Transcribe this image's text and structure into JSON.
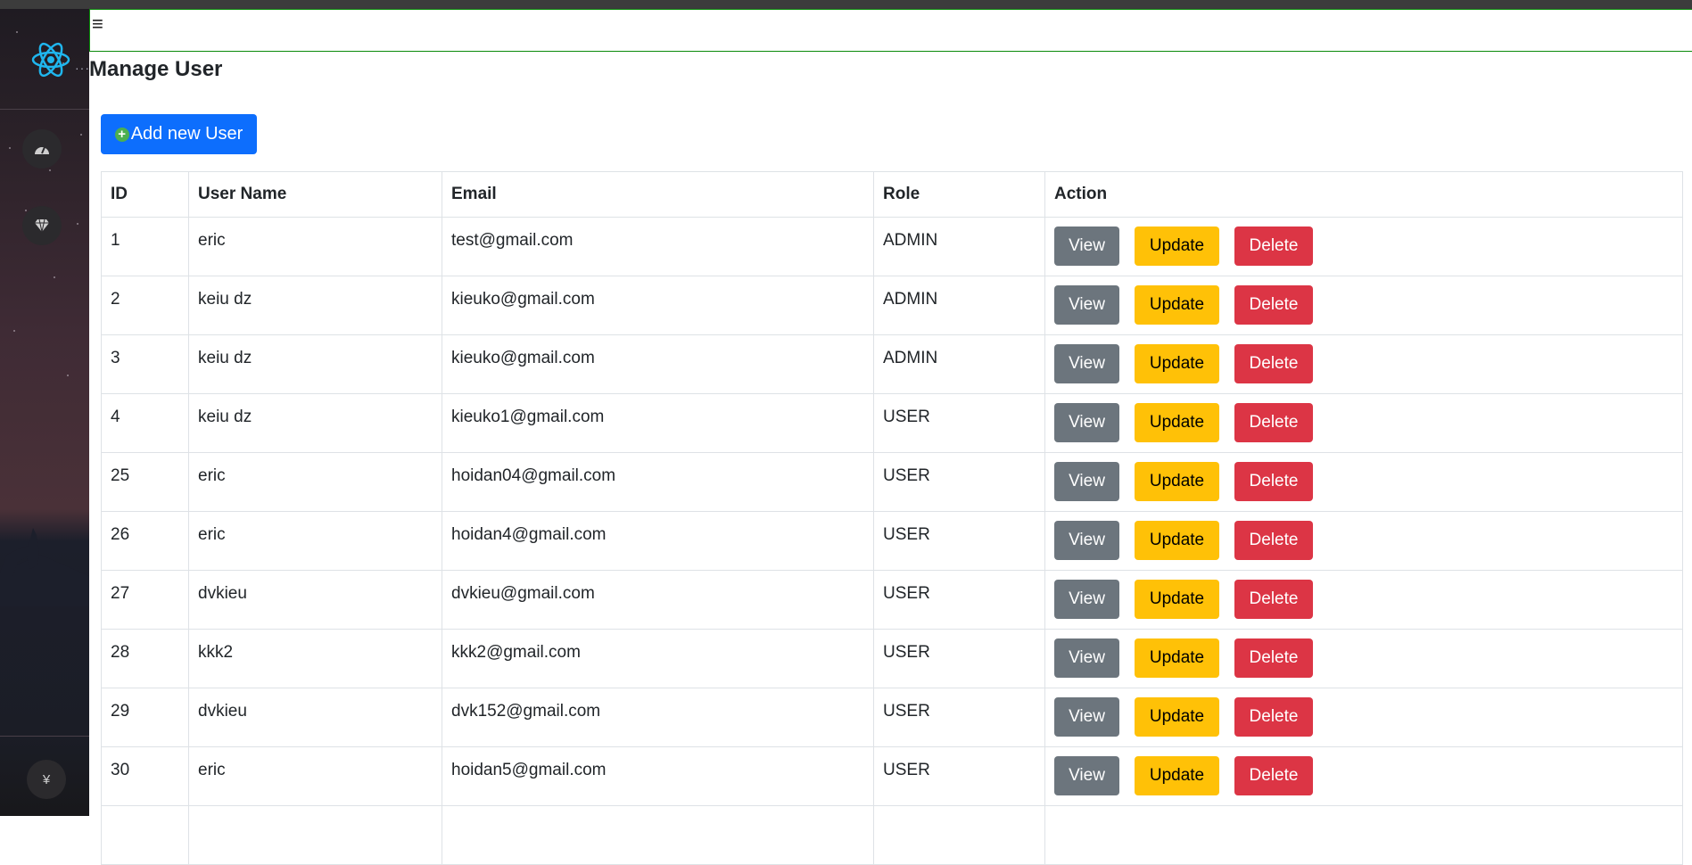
{
  "header": {
    "menu_icon": "hamburger-icon"
  },
  "page": {
    "title": "Manage User",
    "add_button": "Add new User"
  },
  "sidebar": {
    "logo": "react-logo",
    "items": [
      {
        "icon": "dashboard-gauge-icon"
      },
      {
        "icon": "diamond-icon"
      }
    ],
    "footer_icon_text": "¥"
  },
  "table": {
    "headers": [
      "ID",
      "User Name",
      "Email",
      "Role",
      "Action"
    ],
    "actions": {
      "view": "View",
      "update": "Update",
      "delete": "Delete"
    },
    "rows": [
      {
        "id": "1",
        "username": "eric",
        "email": "test@gmail.com",
        "role": "ADMIN"
      },
      {
        "id": "2",
        "username": "keiu dz",
        "email": "kieuko@gmail.com",
        "role": "ADMIN"
      },
      {
        "id": "3",
        "username": "keiu dz",
        "email": "kieuko@gmail.com",
        "role": "ADMIN"
      },
      {
        "id": "4",
        "username": "keiu dz",
        "email": "kieuko1@gmail.com",
        "role": "USER"
      },
      {
        "id": "25",
        "username": "eric",
        "email": "hoidan04@gmail.com",
        "role": "USER"
      },
      {
        "id": "26",
        "username": "eric",
        "email": "hoidan4@gmail.com",
        "role": "USER"
      },
      {
        "id": "27",
        "username": "dvkieu",
        "email": "dvkieu@gmail.com",
        "role": "USER"
      },
      {
        "id": "28",
        "username": "kkk2",
        "email": "kkk2@gmail.com",
        "role": "USER"
      },
      {
        "id": "29",
        "username": "dvkieu",
        "email": "dvk152@gmail.com",
        "role": "USER"
      },
      {
        "id": "30",
        "username": "eric",
        "email": "hoidan5@gmail.com",
        "role": "USER"
      }
    ]
  },
  "colors": {
    "primary": "#0d6efd",
    "secondary": "#6c757d",
    "warning": "#ffc107",
    "danger": "#dc3545",
    "header_border": "#0a8a0a"
  }
}
